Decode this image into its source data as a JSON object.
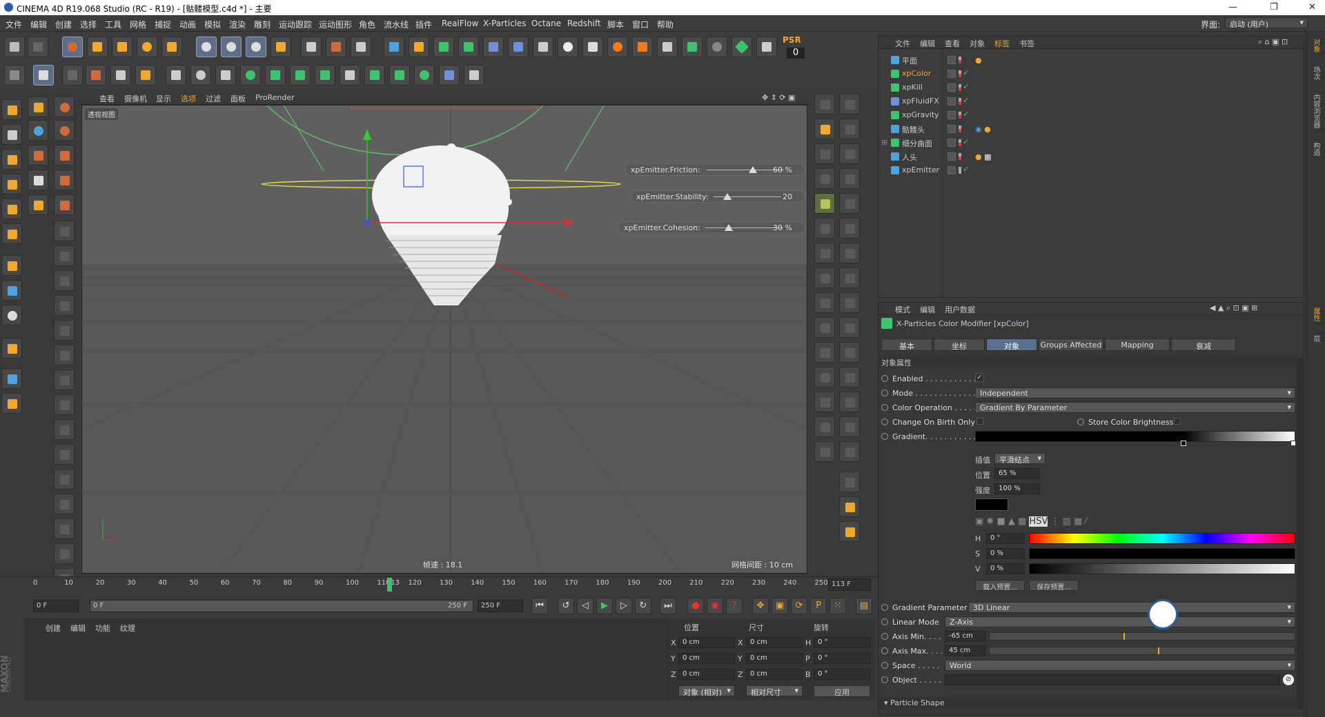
{
  "titlebar": {
    "title": "CINEMA 4D R19.068 Studio (RC - R19) - [骷髅模型.c4d *] - 主要",
    "min": "—",
    "max": "❐",
    "close": "✕"
  },
  "menu": [
    "文件",
    "编辑",
    "创建",
    "选择",
    "工具",
    "网格",
    "捕捉",
    "动画",
    "模拟",
    "渲染",
    "雕刻",
    "运动跟踪",
    "运动图形",
    "角色",
    "流水线",
    "插件",
    "RealFlow",
    "X-Particles",
    "Octane",
    "Redshift",
    "脚本",
    "窗口",
    "帮助"
  ],
  "layout": {
    "label": "界面:",
    "value": "启动 (用户)"
  },
  "psr": {
    "label": "PSR",
    "value": "0"
  },
  "viewport": {
    "menu": [
      "查看",
      "摄像机",
      "显示",
      "选项",
      "过滤",
      "面板",
      "ProRender"
    ],
    "label": "透视视图",
    "fps": "帧速 : 18.1",
    "grid": "网格间距 : 10 cm",
    "sliders": [
      {
        "name": "xpEmitter.Friction:",
        "value": "60 %",
        "level": 0.6
      },
      {
        "name": "xpEmitter.Stability:",
        "value": "20",
        "level": 0.2
      },
      {
        "name": "xpEmitter.Cohesion:",
        "value": "30 %",
        "level": 0.3
      }
    ]
  },
  "timeline": {
    "ticks": [
      "0",
      "10",
      "20",
      "30",
      "40",
      "50",
      "60",
      "70",
      "80",
      "90",
      "100",
      "110",
      "113",
      "120",
      "130",
      "140",
      "150",
      "160",
      "170",
      "180",
      "190",
      "200",
      "210",
      "220",
      "230",
      "240",
      "250"
    ],
    "current": "113 F",
    "start": "0 F",
    "range_start": "0 F",
    "range_end": "250 F",
    "end": "250 F"
  },
  "material": {
    "menu": [
      "创建",
      "编辑",
      "功能",
      "纹理"
    ]
  },
  "coords": {
    "headers": [
      "位置",
      "尺寸",
      "旋转"
    ],
    "rows": [
      {
        "axis": "X",
        "pos": "0 cm",
        "size_axis": "X",
        "size": "0 cm",
        "rot_axis": "H",
        "rot": "0 °"
      },
      {
        "axis": "Y",
        "pos": "0 cm",
        "size_axis": "Y",
        "size": "0 cm",
        "rot_axis": "P",
        "rot": "0 °"
      },
      {
        "axis": "Z",
        "pos": "0 cm",
        "size_axis": "Z",
        "size": "0 cm",
        "rot_axis": "B",
        "rot": "0 °"
      }
    ],
    "mode": "对象 (相对)",
    "size_mode": "相对尺寸",
    "apply": "应用"
  },
  "maxon": {
    "line1": "MAXON",
    "line2": "CINEMA 4D"
  },
  "objects": {
    "menu": [
      "文件",
      "编辑",
      "查看",
      "对象",
      "标签",
      "书签"
    ],
    "items": [
      {
        "name": "平面",
        "color": "#4da3e0"
      },
      {
        "name": "xpColor",
        "color": "#3ec46b",
        "selected": true
      },
      {
        "name": "xpKill",
        "color": "#3ec46b"
      },
      {
        "name": "xpFluidFX",
        "color": "#6f8fd8"
      },
      {
        "name": "xpGravity",
        "color": "#3ec46b"
      },
      {
        "name": "骷髅头",
        "color": "#4da3e0"
      },
      {
        "name": "细分曲面",
        "color": "#3ec46b"
      },
      {
        "name": "人头",
        "color": "#4da3e0"
      },
      {
        "name": "xpEmitter",
        "color": "#4da3e0"
      }
    ]
  },
  "attributes": {
    "menu": [
      "模式",
      "编辑",
      "用户数据"
    ],
    "title": "X-Particles Color Modifier [xpColor]",
    "tabs": [
      "基本",
      "坐标",
      "对象",
      "Groups Affected",
      "Mapping",
      "衰减"
    ],
    "section": "对象属性",
    "enabled_label": "Enabled . . . . . . . . . . . .",
    "enabled_value": "✓",
    "mode_label": "Mode . . . . . . . . . . . . . .",
    "mode_value": "Independent",
    "color_op_label": "Color Operation . . . . . . .",
    "color_op_value": "Gradient By Parameter",
    "change_birth_label": "Change On Birth Only",
    "store_bright_label": "Store Color Brightness",
    "gradient_label": "Gradient. . . . . . . . . . . .",
    "interp_label": "插值",
    "interp_value": "平滑结点",
    "pos_label": "位置",
    "pos_value": "65 %",
    "strength_label": "强度",
    "strength_value": "100 %",
    "h_label": "H",
    "h_value": "0 °",
    "s_label": "S",
    "s_value": "0 %",
    "v_label": "V",
    "v_value": "0 %",
    "load_preset": "载入预置...",
    "save_preset": "保存预置...",
    "grad_param_label": "Gradient Parameter",
    "grad_param_value": "3D Linear",
    "linear_mode_label": "Linear Mode",
    "linear_mode_value": "Z-Axis",
    "axis_min_label": "Axis Min. . . .",
    "axis_min_value": "-65 cm",
    "axis_max_label": "Axis Max. . . .",
    "axis_max_value": "45 cm",
    "space_label": "Space . . . . .",
    "space_value": "World",
    "object_label": "Object . . . . .",
    "particle_shape": "▾ Particle Shape"
  },
  "right_strip": [
    "对象",
    "场次",
    "内容浏览器",
    "构造",
    "属性",
    "层"
  ],
  "colors": {
    "accent": "#5a6f8e",
    "selected": "#f0a830",
    "viewport_bg": "#5f5f5f"
  }
}
